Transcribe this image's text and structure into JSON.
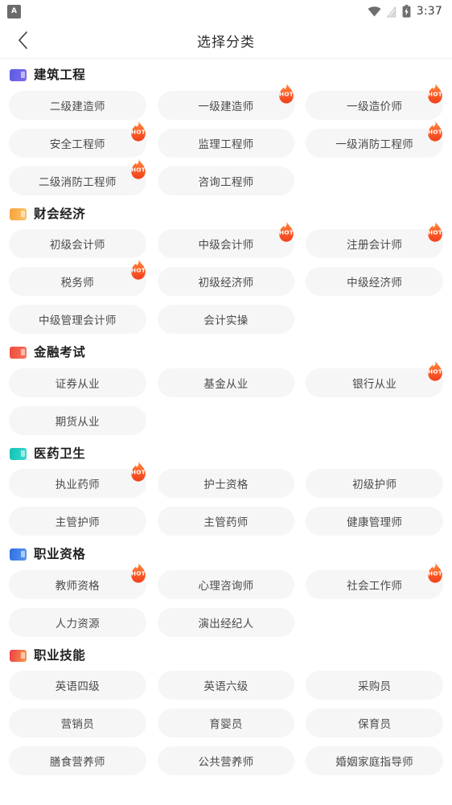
{
  "status_bar": {
    "app_badge_letter": "A",
    "icons": [
      "wifi-icon",
      "signal-icon",
      "battery-icon"
    ],
    "time": "3:37"
  },
  "nav": {
    "back_icon": "chevron-left-icon",
    "title": "选择分类"
  },
  "hot_badge_label": "HOT",
  "sections": [
    {
      "title": "建筑工程",
      "icon_color_start": "#5b5ce2",
      "icon_color_end": "#7f6bf0",
      "items": [
        {
          "label": "二级建造师",
          "hot": false
        },
        {
          "label": "一级建造师",
          "hot": true
        },
        {
          "label": "一级造价师",
          "hot": true
        },
        {
          "label": "安全工程师",
          "hot": true
        },
        {
          "label": "监理工程师",
          "hot": false
        },
        {
          "label": "一级消防工程师",
          "hot": true
        },
        {
          "label": "二级消防工程师",
          "hot": true
        },
        {
          "label": "咨询工程师",
          "hot": false
        }
      ]
    },
    {
      "title": "财会经济",
      "icon_color_start": "#f7a23b",
      "icon_color_end": "#fbc56a",
      "items": [
        {
          "label": "初级会计师",
          "hot": false
        },
        {
          "label": "中级会计师",
          "hot": true
        },
        {
          "label": "注册会计师",
          "hot": true
        },
        {
          "label": "税务师",
          "hot": true
        },
        {
          "label": "初级经济师",
          "hot": false
        },
        {
          "label": "中级经济师",
          "hot": false
        },
        {
          "label": "中级管理会计师",
          "hot": false
        },
        {
          "label": "会计实操",
          "hot": false
        }
      ]
    },
    {
      "title": "金融考试",
      "icon_color_start": "#ef4b3c",
      "icon_color_end": "#f7765c",
      "items": [
        {
          "label": "证券从业",
          "hot": false
        },
        {
          "label": "基金从业",
          "hot": false
        },
        {
          "label": "银行从业",
          "hot": true
        },
        {
          "label": "期货从业",
          "hot": false
        }
      ]
    },
    {
      "title": "医药卫生",
      "icon_color_start": "#13c4b6",
      "icon_color_end": "#38d9cd",
      "items": [
        {
          "label": "执业药师",
          "hot": true
        },
        {
          "label": "护士资格",
          "hot": false
        },
        {
          "label": "初级护师",
          "hot": false
        },
        {
          "label": "主管护师",
          "hot": false
        },
        {
          "label": "主管药师",
          "hot": false
        },
        {
          "label": "健康管理师",
          "hot": false
        }
      ]
    },
    {
      "title": "职业资格",
      "icon_color_start": "#2f6fe0",
      "icon_color_end": "#5a95f2",
      "items": [
        {
          "label": "教师资格",
          "hot": true
        },
        {
          "label": "心理咨询师",
          "hot": false
        },
        {
          "label": "社会工作师",
          "hot": true
        },
        {
          "label": "人力资源",
          "hot": false
        },
        {
          "label": "演出经纪人",
          "hot": false
        }
      ]
    },
    {
      "title": "职业技能",
      "icon_color_start": "#ef3b46",
      "icon_color_end": "#f59b4e",
      "items": [
        {
          "label": "英语四级",
          "hot": false
        },
        {
          "label": "英语六级",
          "hot": false
        },
        {
          "label": "采购员",
          "hot": false
        },
        {
          "label": "营销员",
          "hot": false
        },
        {
          "label": "育婴员",
          "hot": false
        },
        {
          "label": "保育员",
          "hot": false
        },
        {
          "label": "膳食营养师",
          "hot": false
        },
        {
          "label": "公共营养师",
          "hot": false
        },
        {
          "label": "婚姻家庭指导师",
          "hot": false
        }
      ]
    }
  ]
}
